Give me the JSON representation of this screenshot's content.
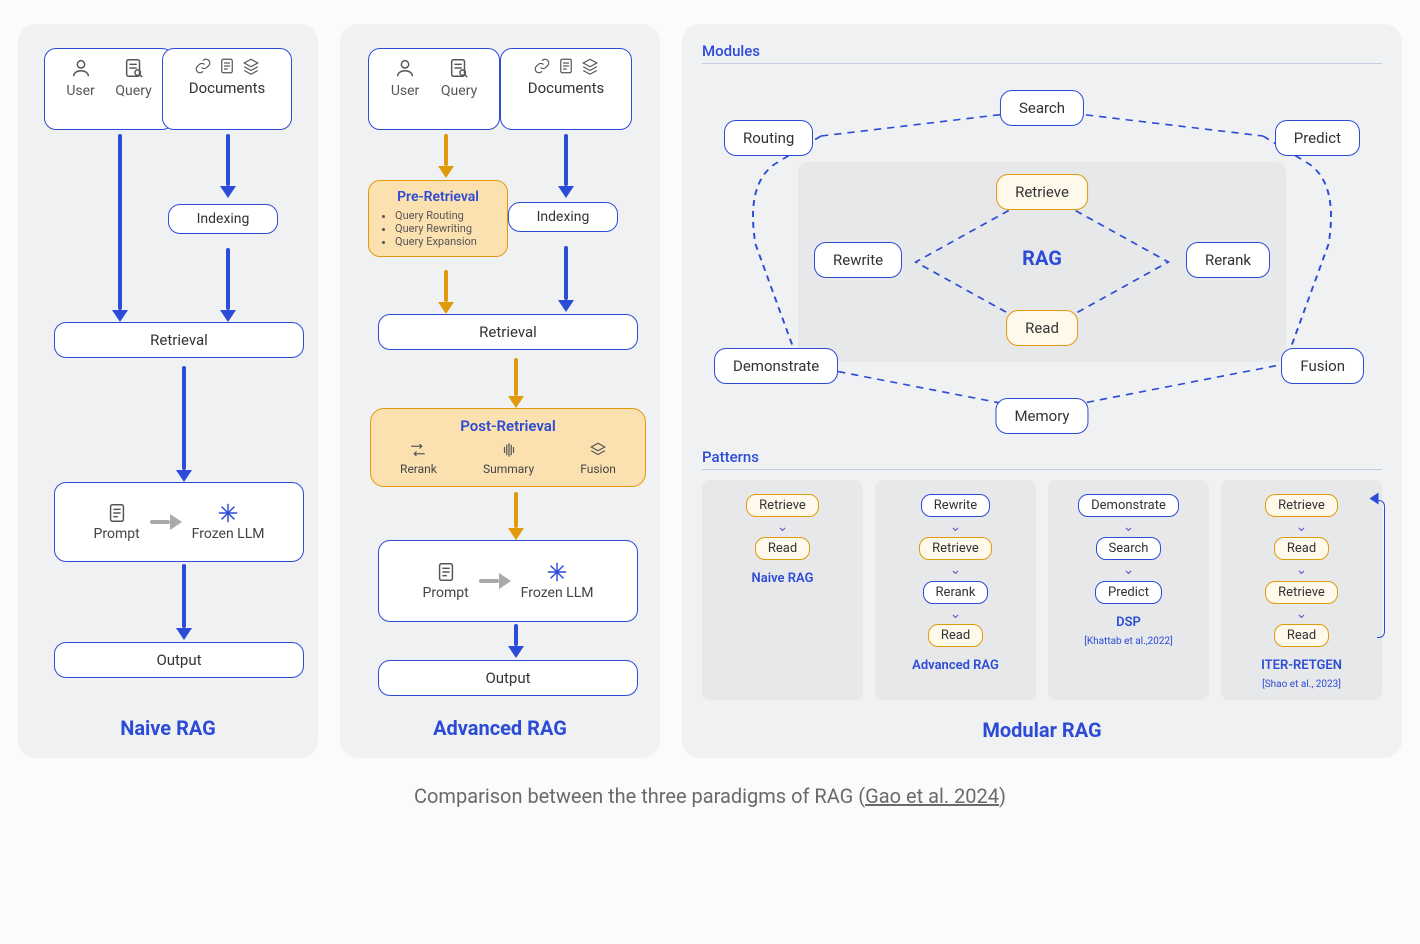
{
  "caption_pre": "Comparison between the three paradigms of RAG (",
  "caption_link": "Gao et al. 2024",
  "caption_post": ")",
  "naive": {
    "title": "Naive RAG",
    "user_query": {
      "user": "User",
      "query": "Query"
    },
    "documents": "Documents",
    "indexing": "Indexing",
    "retrieval": "Retrieval",
    "prompt": "Prompt",
    "frozen": "Frozen LLM",
    "output": "Output"
  },
  "advanced": {
    "title": "Advanced RAG",
    "user_query": {
      "user": "User",
      "query": "Query"
    },
    "documents": "Documents",
    "pre": {
      "title": "Pre-Retrieval",
      "items": [
        "Query Routing",
        "Query Rewriting",
        "Query Expansion"
      ]
    },
    "indexing": "Indexing",
    "retrieval": "Retrieval",
    "post": {
      "title": "Post-Retrieval",
      "rerank": "Rerank",
      "summary": "Summary",
      "fusion": "Fusion"
    },
    "prompt": "Prompt",
    "frozen": "Frozen LLM",
    "output": "Output"
  },
  "modular": {
    "title": "Modular RAG",
    "modules_label": "Modules",
    "patterns_label": "Patterns",
    "rag_label": "RAG",
    "modules": {
      "search": "Search",
      "routing": "Routing",
      "predict": "Predict",
      "retrieve": "Retrieve",
      "rewrite": "Rewrite",
      "rerank": "Rerank",
      "read": "Read",
      "demonstrate": "Demonstrate",
      "fusion": "Fusion",
      "memory": "Memory"
    },
    "patterns": [
      {
        "name": "Naive RAG",
        "sub": "",
        "steps": [
          {
            "label": "Retrieve",
            "style": "or"
          },
          {
            "label": "Read",
            "style": "or"
          }
        ]
      },
      {
        "name": "Advanced RAG",
        "sub": "",
        "steps": [
          {
            "label": "Rewrite",
            "style": "b"
          },
          {
            "label": "Retrieve",
            "style": "or"
          },
          {
            "label": "Rerank",
            "style": "b"
          },
          {
            "label": "Read",
            "style": "or"
          }
        ]
      },
      {
        "name": "DSP",
        "sub": "[Khattab et al.,2022]",
        "steps": [
          {
            "label": "Demonstrate",
            "style": "b"
          },
          {
            "label": "Search",
            "style": "b"
          },
          {
            "label": "Predict",
            "style": "b"
          }
        ]
      },
      {
        "name": "ITER-RETGEN",
        "sub": "[Shao et al., 2023]",
        "loop": true,
        "steps": [
          {
            "label": "Retrieve",
            "style": "or"
          },
          {
            "label": "Read",
            "style": "or"
          },
          {
            "label": "Retrieve",
            "style": "or"
          },
          {
            "label": "Read",
            "style": "or"
          }
        ]
      }
    ]
  }
}
